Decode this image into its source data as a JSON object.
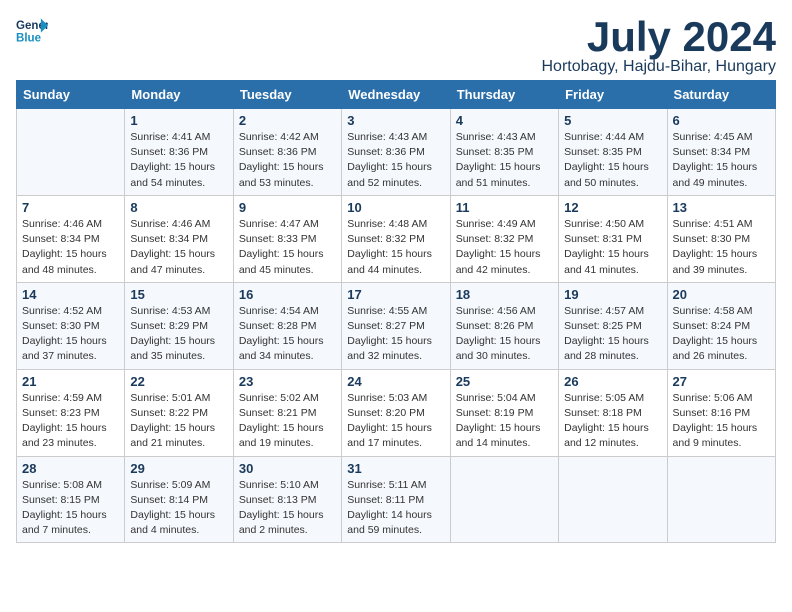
{
  "header": {
    "logo_line1": "General",
    "logo_line2": "Blue",
    "month": "July 2024",
    "location": "Hortobagy, Hajdu-Bihar, Hungary"
  },
  "days_of_week": [
    "Sunday",
    "Monday",
    "Tuesday",
    "Wednesday",
    "Thursday",
    "Friday",
    "Saturday"
  ],
  "weeks": [
    [
      {
        "day": "",
        "info": ""
      },
      {
        "day": "1",
        "info": "Sunrise: 4:41 AM\nSunset: 8:36 PM\nDaylight: 15 hours\nand 54 minutes."
      },
      {
        "day": "2",
        "info": "Sunrise: 4:42 AM\nSunset: 8:36 PM\nDaylight: 15 hours\nand 53 minutes."
      },
      {
        "day": "3",
        "info": "Sunrise: 4:43 AM\nSunset: 8:36 PM\nDaylight: 15 hours\nand 52 minutes."
      },
      {
        "day": "4",
        "info": "Sunrise: 4:43 AM\nSunset: 8:35 PM\nDaylight: 15 hours\nand 51 minutes."
      },
      {
        "day": "5",
        "info": "Sunrise: 4:44 AM\nSunset: 8:35 PM\nDaylight: 15 hours\nand 50 minutes."
      },
      {
        "day": "6",
        "info": "Sunrise: 4:45 AM\nSunset: 8:34 PM\nDaylight: 15 hours\nand 49 minutes."
      }
    ],
    [
      {
        "day": "7",
        "info": "Sunrise: 4:46 AM\nSunset: 8:34 PM\nDaylight: 15 hours\nand 48 minutes."
      },
      {
        "day": "8",
        "info": "Sunrise: 4:46 AM\nSunset: 8:34 PM\nDaylight: 15 hours\nand 47 minutes."
      },
      {
        "day": "9",
        "info": "Sunrise: 4:47 AM\nSunset: 8:33 PM\nDaylight: 15 hours\nand 45 minutes."
      },
      {
        "day": "10",
        "info": "Sunrise: 4:48 AM\nSunset: 8:32 PM\nDaylight: 15 hours\nand 44 minutes."
      },
      {
        "day": "11",
        "info": "Sunrise: 4:49 AM\nSunset: 8:32 PM\nDaylight: 15 hours\nand 42 minutes."
      },
      {
        "day": "12",
        "info": "Sunrise: 4:50 AM\nSunset: 8:31 PM\nDaylight: 15 hours\nand 41 minutes."
      },
      {
        "day": "13",
        "info": "Sunrise: 4:51 AM\nSunset: 8:30 PM\nDaylight: 15 hours\nand 39 minutes."
      }
    ],
    [
      {
        "day": "14",
        "info": "Sunrise: 4:52 AM\nSunset: 8:30 PM\nDaylight: 15 hours\nand 37 minutes."
      },
      {
        "day": "15",
        "info": "Sunrise: 4:53 AM\nSunset: 8:29 PM\nDaylight: 15 hours\nand 35 minutes."
      },
      {
        "day": "16",
        "info": "Sunrise: 4:54 AM\nSunset: 8:28 PM\nDaylight: 15 hours\nand 34 minutes."
      },
      {
        "day": "17",
        "info": "Sunrise: 4:55 AM\nSunset: 8:27 PM\nDaylight: 15 hours\nand 32 minutes."
      },
      {
        "day": "18",
        "info": "Sunrise: 4:56 AM\nSunset: 8:26 PM\nDaylight: 15 hours\nand 30 minutes."
      },
      {
        "day": "19",
        "info": "Sunrise: 4:57 AM\nSunset: 8:25 PM\nDaylight: 15 hours\nand 28 minutes."
      },
      {
        "day": "20",
        "info": "Sunrise: 4:58 AM\nSunset: 8:24 PM\nDaylight: 15 hours\nand 26 minutes."
      }
    ],
    [
      {
        "day": "21",
        "info": "Sunrise: 4:59 AM\nSunset: 8:23 PM\nDaylight: 15 hours\nand 23 minutes."
      },
      {
        "day": "22",
        "info": "Sunrise: 5:01 AM\nSunset: 8:22 PM\nDaylight: 15 hours\nand 21 minutes."
      },
      {
        "day": "23",
        "info": "Sunrise: 5:02 AM\nSunset: 8:21 PM\nDaylight: 15 hours\nand 19 minutes."
      },
      {
        "day": "24",
        "info": "Sunrise: 5:03 AM\nSunset: 8:20 PM\nDaylight: 15 hours\nand 17 minutes."
      },
      {
        "day": "25",
        "info": "Sunrise: 5:04 AM\nSunset: 8:19 PM\nDaylight: 15 hours\nand 14 minutes."
      },
      {
        "day": "26",
        "info": "Sunrise: 5:05 AM\nSunset: 8:18 PM\nDaylight: 15 hours\nand 12 minutes."
      },
      {
        "day": "27",
        "info": "Sunrise: 5:06 AM\nSunset: 8:16 PM\nDaylight: 15 hours\nand 9 minutes."
      }
    ],
    [
      {
        "day": "28",
        "info": "Sunrise: 5:08 AM\nSunset: 8:15 PM\nDaylight: 15 hours\nand 7 minutes."
      },
      {
        "day": "29",
        "info": "Sunrise: 5:09 AM\nSunset: 8:14 PM\nDaylight: 15 hours\nand 4 minutes."
      },
      {
        "day": "30",
        "info": "Sunrise: 5:10 AM\nSunset: 8:13 PM\nDaylight: 15 hours\nand 2 minutes."
      },
      {
        "day": "31",
        "info": "Sunrise: 5:11 AM\nSunset: 8:11 PM\nDaylight: 14 hours\nand 59 minutes."
      },
      {
        "day": "",
        "info": ""
      },
      {
        "day": "",
        "info": ""
      },
      {
        "day": "",
        "info": ""
      }
    ]
  ]
}
